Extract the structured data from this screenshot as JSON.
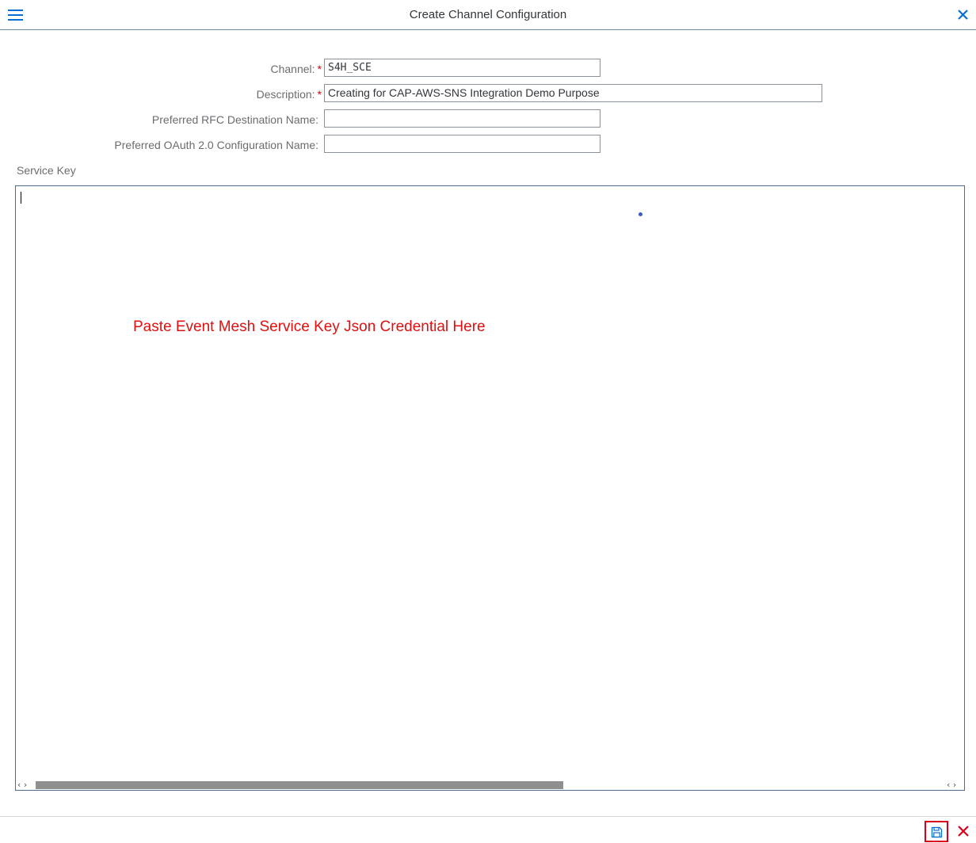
{
  "window": {
    "title": "Create Channel Configuration"
  },
  "form": {
    "channel": {
      "label": "Channel:",
      "required_marker": "*",
      "value": "S4H_SCE"
    },
    "description": {
      "label": "Description:",
      "required_marker": "*",
      "value": "Creating for CAP-AWS-SNS Integration Demo Purpose"
    },
    "rfc_destination": {
      "label": "Preferred RFC Destination Name:",
      "value": ""
    },
    "oauth_config": {
      "label": "Preferred OAuth 2.0 Configuration Name:",
      "value": ""
    }
  },
  "service_key": {
    "label": "Service Key",
    "annotation": "Paste Event Mesh Service Key Json Credential Here",
    "scroll_left": "‹ ›",
    "scroll_right": "‹ ›"
  },
  "colors": {
    "accent": "#0a6ed1",
    "required": "#e00000",
    "annotation": "#e01010",
    "highlight_border": "#d9001b",
    "cancel": "#d9001b"
  },
  "icons": {
    "menu": "hamburger-menu-icon",
    "close": "close-icon",
    "save": "save-icon",
    "cancel": "cancel-icon"
  }
}
